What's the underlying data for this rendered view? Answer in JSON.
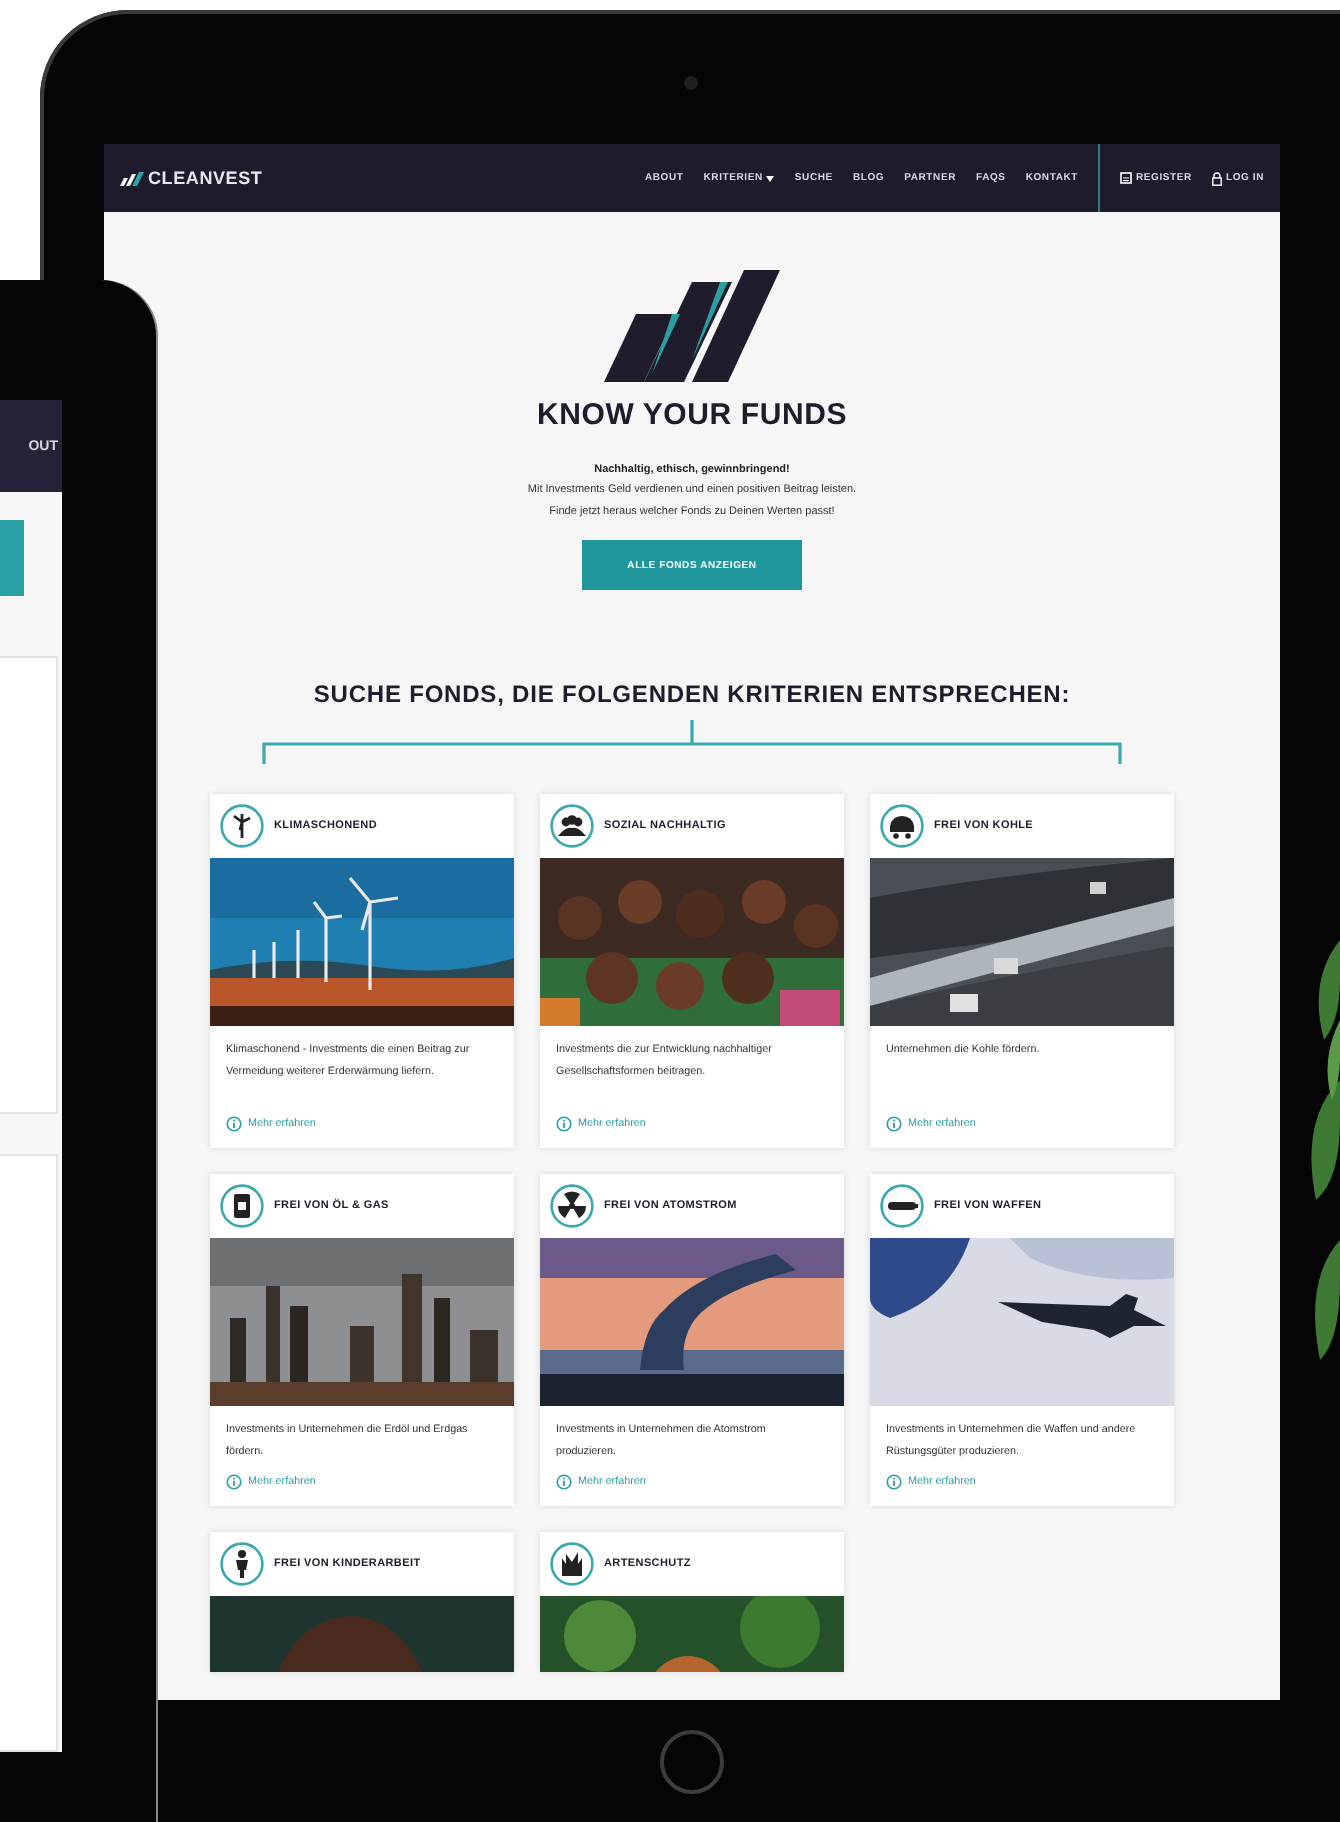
{
  "phone": {
    "nav_label": "OUT"
  },
  "site": {
    "logo": "CLEANVEST",
    "nav": [
      {
        "label": "ABOUT",
        "kind": "link"
      },
      {
        "label": "KRITERIEN",
        "kind": "dropdown"
      },
      {
        "label": "SUCHE",
        "kind": "link"
      },
      {
        "label": "BLOG",
        "kind": "link"
      },
      {
        "label": "PARTNER",
        "kind": "link"
      },
      {
        "label": "FAQS",
        "kind": "link"
      },
      {
        "label": "KONTAKT",
        "kind": "link"
      },
      {
        "label": "REGISTER",
        "kind": "register"
      },
      {
        "label": "LOG IN",
        "kind": "login"
      }
    ]
  },
  "hero": {
    "title": "KNOW YOUR FUNDS",
    "tagline": "Nachhaltig, ethisch, gewinnbringend!",
    "lines": [
      "Mit Investments Geld verdienen und einen positiven Beitrag leisten.",
      "Finde jetzt heraus welcher Fonds zu Deinen Werten passt!"
    ],
    "button": "ALLE FONDS ANZEIGEN"
  },
  "criteria": {
    "heading": "SUCHE FONDS, DIE FOLGENDEN KRITERIEN ENTSPRECHEN:",
    "cards": [
      {
        "kind": "climate",
        "title": "KLIMASCHONEND",
        "description": "Klimaschonend - Investments die einen Beitrag zur Vermeidung weiterer Erderwärmung liefern.",
        "link": "Mehr erfahren"
      },
      {
        "kind": "social",
        "title": "SOZIAL NACHHALTIG",
        "description": "Investments die zur Entwicklung nachhaltiger Gesellschaftsformen beitragen.",
        "link": "Mehr erfahren"
      },
      {
        "kind": "coal",
        "title": "FREI VON KOHLE",
        "description": "Unternehmen die Kohle fördern.",
        "link": "Mehr erfahren"
      },
      {
        "kind": "oil",
        "title": "FREI VON ÖL & GAS",
        "description": "Investments in Unternehmen die Erdöl und Erdgas fördern.",
        "link": "Mehr erfahren"
      },
      {
        "kind": "nuclear",
        "title": "FREI VON ATOMSTROM",
        "description": "Investments in Unternehmen die Atomstrom produzieren.",
        "link": "Mehr erfahren"
      },
      {
        "kind": "weapons",
        "title": "FREI VON WAFFEN",
        "description": "Investments in Unternehmen die Waffen und andere Rüstungsgüter produzieren.",
        "link": "Mehr erfahren"
      },
      {
        "kind": "children",
        "title": "FREI VON KINDERARBEIT"
      },
      {
        "kind": "species",
        "title": "ARTENSCHUTZ"
      }
    ]
  }
}
